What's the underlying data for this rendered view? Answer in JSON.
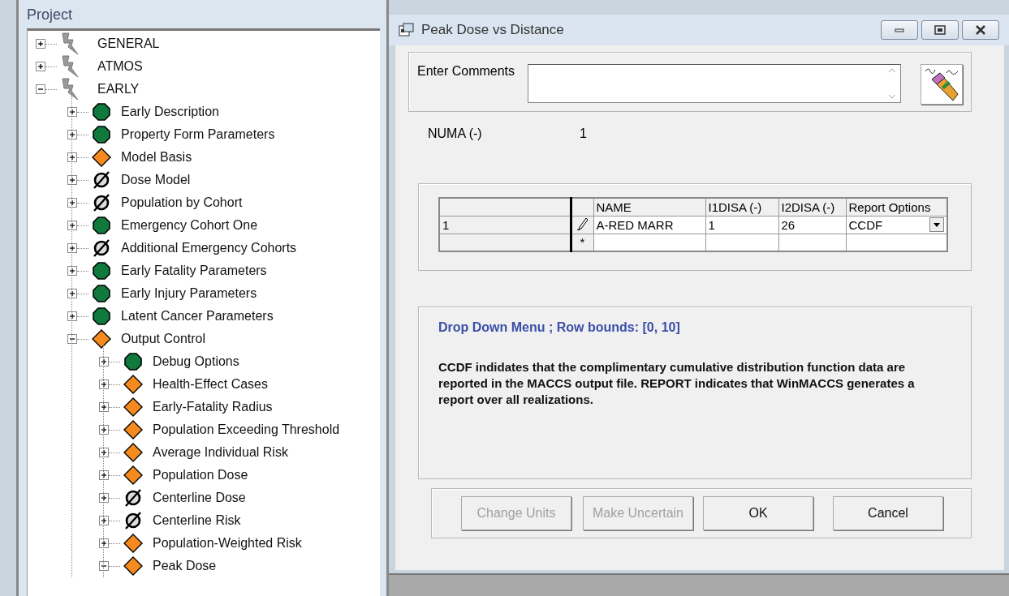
{
  "project_panel": {
    "title": "Project",
    "tree": [
      {
        "label": "GENERAL",
        "kind": "module",
        "expanded": false
      },
      {
        "label": "ATMOS",
        "kind": "module",
        "expanded": false
      },
      {
        "label": "EARLY",
        "kind": "module",
        "expanded": true,
        "children": [
          {
            "label": "Early Description",
            "kind": "complete",
            "expanded": false
          },
          {
            "label": "Property Form Parameters",
            "kind": "complete",
            "expanded": false
          },
          {
            "label": "Model Basis",
            "kind": "incomplete",
            "expanded": false
          },
          {
            "label": "Dose Model",
            "kind": "empty",
            "expanded": false
          },
          {
            "label": "Population by Cohort",
            "kind": "empty",
            "expanded": false
          },
          {
            "label": "Emergency Cohort One",
            "kind": "complete",
            "expanded": false
          },
          {
            "label": "Additional Emergency Cohorts",
            "kind": "empty",
            "expanded": false
          },
          {
            "label": "Early Fatality Parameters",
            "kind": "complete",
            "expanded": false
          },
          {
            "label": "Early Injury Parameters",
            "kind": "complete",
            "expanded": false
          },
          {
            "label": "Latent Cancer Parameters",
            "kind": "complete",
            "expanded": false
          },
          {
            "label": "Output Control",
            "kind": "incomplete",
            "expanded": true,
            "children": [
              {
                "label": "Debug Options",
                "kind": "complete",
                "expanded": false
              },
              {
                "label": "Health-Effect Cases",
                "kind": "incomplete",
                "expanded": false
              },
              {
                "label": "Early-Fatality Radius",
                "kind": "incomplete",
                "expanded": false
              },
              {
                "label": "Population Exceeding Threshold",
                "kind": "incomplete",
                "expanded": false
              },
              {
                "label": "Average Individual Risk",
                "kind": "incomplete",
                "expanded": false
              },
              {
                "label": "Population Dose",
                "kind": "incomplete",
                "expanded": false
              },
              {
                "label": "Centerline Dose",
                "kind": "empty",
                "expanded": false
              },
              {
                "label": "Centerline Risk",
                "kind": "empty",
                "expanded": false
              },
              {
                "label": "Population-Weighted Risk",
                "kind": "incomplete",
                "expanded": false
              },
              {
                "label": "Peak Dose",
                "kind": "incomplete",
                "expanded": true
              }
            ]
          }
        ]
      }
    ]
  },
  "dialog": {
    "title": "Peak Dose vs Distance",
    "comments": {
      "label": "Enter Comments"
    },
    "numa": {
      "label": "NUMA (-)",
      "value": "1"
    },
    "grid": {
      "columns": [
        {
          "label": "NAME",
          "kind": "text"
        },
        {
          "label": "I1DISA (-)",
          "kind": "text"
        },
        {
          "label": "I2DISA (-)",
          "kind": "text"
        },
        {
          "label": "Report Options",
          "kind": "dropdown"
        }
      ],
      "rows": [
        {
          "header": "1",
          "kind": "edit",
          "cells": [
            "A-RED MARR",
            "1",
            "26",
            "CCDF"
          ]
        },
        {
          "kind": "new",
          "marker": "*"
        }
      ]
    },
    "help": {
      "title": "Drop Down Menu ; Row bounds: [0, 10]",
      "text": "CCDF indidates that the complimentary cumulative distribution function data are reported in the MACCS output file. REPORT indicates that WinMACCS generates a report over all realizations."
    },
    "buttons": [
      {
        "label": "Change Units",
        "disabled": true
      },
      {
        "label": "Make Uncertain",
        "disabled": true
      },
      {
        "label": "OK",
        "disabled": false
      },
      {
        "label": "Cancel",
        "disabled": false
      }
    ]
  }
}
